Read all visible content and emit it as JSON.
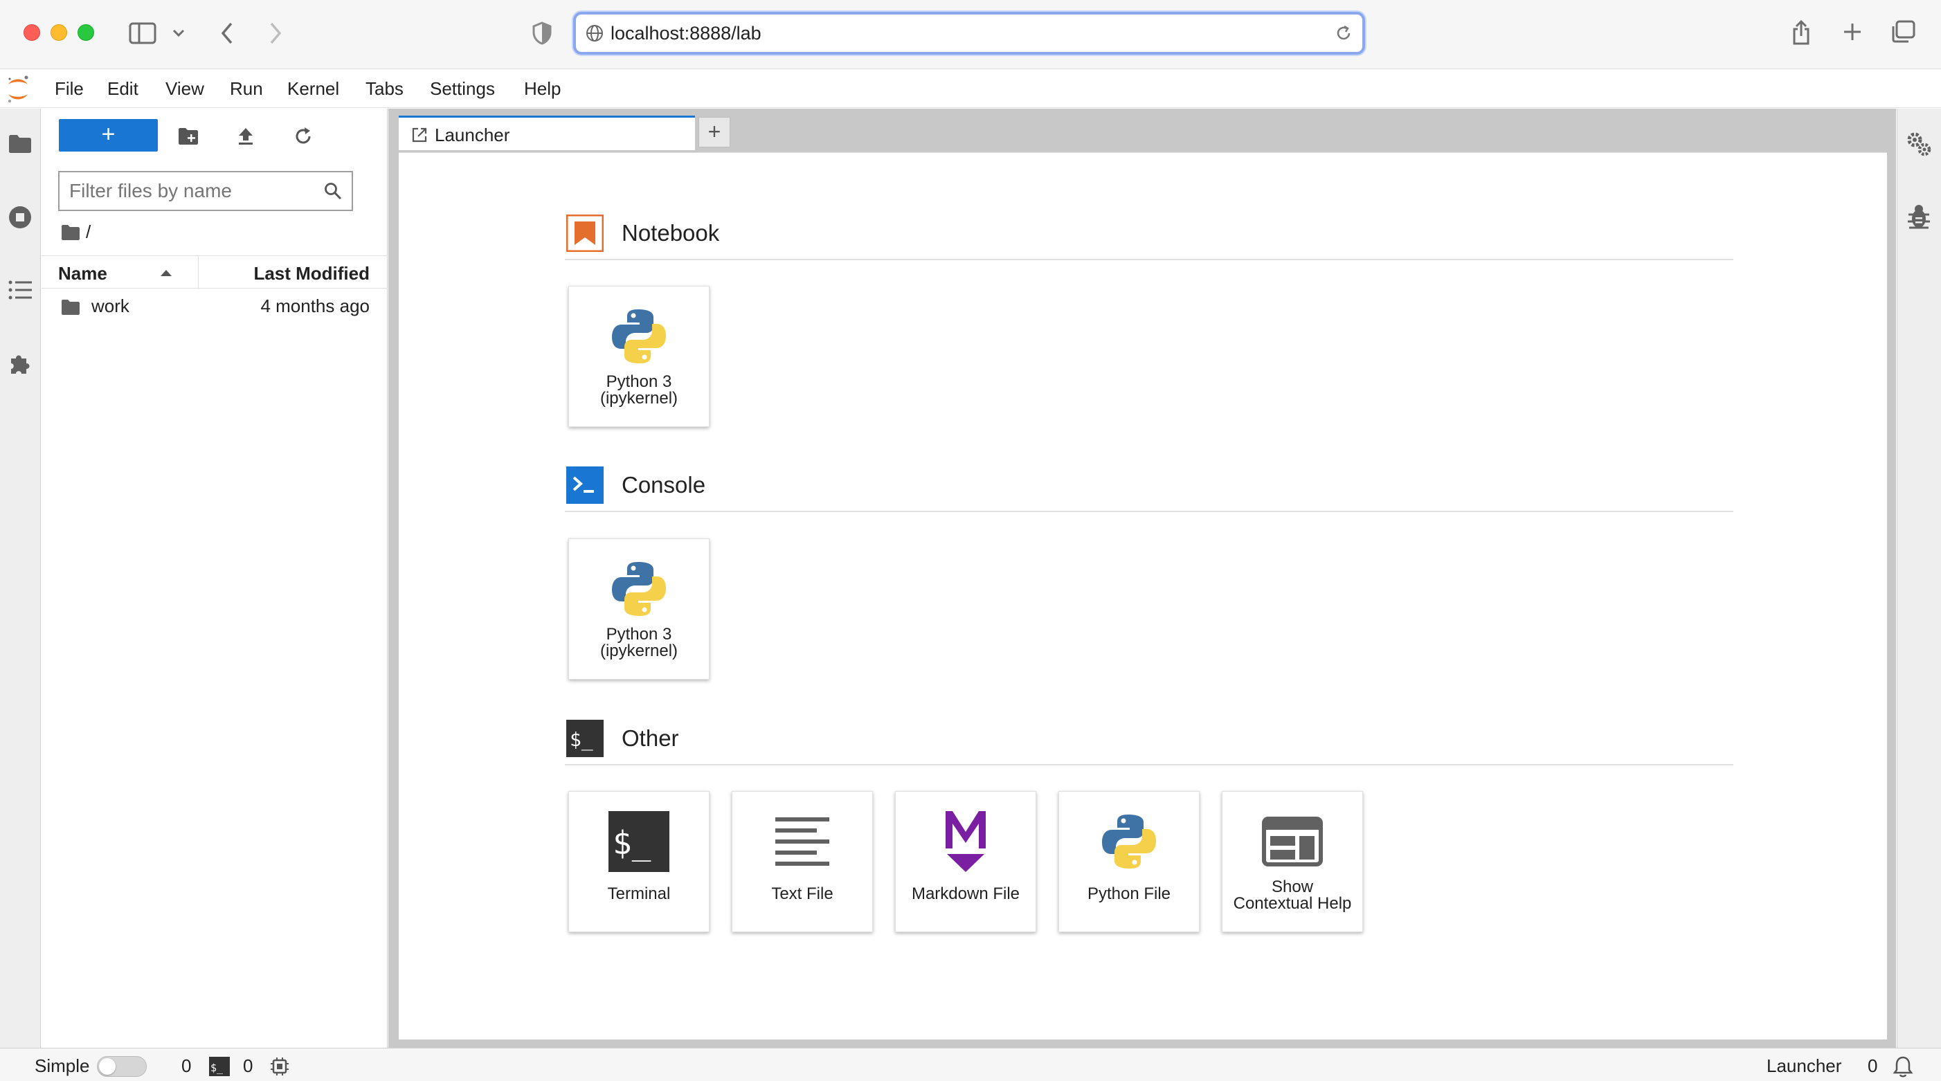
{
  "browser": {
    "url": "localhost:8888/lab"
  },
  "menu": {
    "items": [
      "File",
      "Edit",
      "View",
      "Run",
      "Kernel",
      "Tabs",
      "Settings",
      "Help"
    ]
  },
  "file_browser": {
    "new_button": "+",
    "filter_placeholder": "Filter files by name",
    "breadcrumb": "/",
    "columns": {
      "name": "Name",
      "modified": "Last Modified"
    },
    "rows": [
      {
        "name": "work",
        "modified": "4 months ago",
        "type": "folder"
      }
    ]
  },
  "tabs": [
    {
      "label": "Launcher",
      "active": true
    }
  ],
  "launcher": {
    "sections": [
      {
        "title": "Notebook",
        "icon": "notebook-icon",
        "color": "#e46e2e",
        "cards": [
          {
            "label_line1": "Python 3",
            "label_line2": "(ipykernel)",
            "icon": "python-logo-icon"
          }
        ]
      },
      {
        "title": "Console",
        "icon": "console-icon",
        "color": "#1976d2",
        "cards": [
          {
            "label_line1": "Python 3",
            "label_line2": "(ipykernel)",
            "icon": "python-logo-icon"
          }
        ]
      },
      {
        "title": "Other",
        "icon": "terminal-section-icon",
        "color": "#333333",
        "cards": [
          {
            "label_line1": "Terminal",
            "icon": "terminal-icon"
          },
          {
            "label_line1": "Text File",
            "icon": "text-file-icon"
          },
          {
            "label_line1": "Markdown File",
            "icon": "markdown-icon"
          },
          {
            "label_line1": "Python File",
            "icon": "python-logo-icon"
          },
          {
            "label_line1": "Show",
            "label_line2": "Contextual Help",
            "icon": "contextual-help-icon"
          }
        ]
      }
    ]
  },
  "status": {
    "mode_label": "Simple",
    "kernels_count": "0",
    "terminals_count": "0",
    "current_tab": "Launcher",
    "notifications_count": "0"
  },
  "colors": {
    "accent": "#1976d2",
    "notebook": "#e46e2e",
    "markdown": "#7b1fa2",
    "python_blue": "#3f72a5",
    "python_yellow": "#f5d04b"
  }
}
